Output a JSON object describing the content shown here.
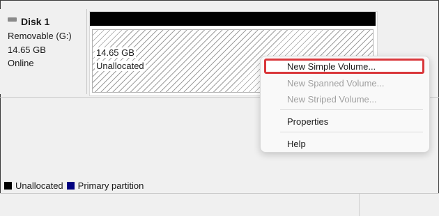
{
  "disk": {
    "title": "Disk 1",
    "type": "Removable (G:)",
    "size": "14.65 GB",
    "status": "Online"
  },
  "segment": {
    "size": "14.65 GB",
    "state": "Unallocated"
  },
  "legend": [
    {
      "label": "Unallocated",
      "color": "#000000"
    },
    {
      "label": "Primary partition",
      "color": "#000080"
    }
  ],
  "context_menu": {
    "new_simple": "New Simple Volume...",
    "new_spanned": "New Spanned Volume...",
    "new_striped": "New Striped Volume...",
    "properties": "Properties",
    "help": "Help"
  },
  "colors": {
    "highlight_border": "#d9373b",
    "panel_cap": "#000000"
  }
}
